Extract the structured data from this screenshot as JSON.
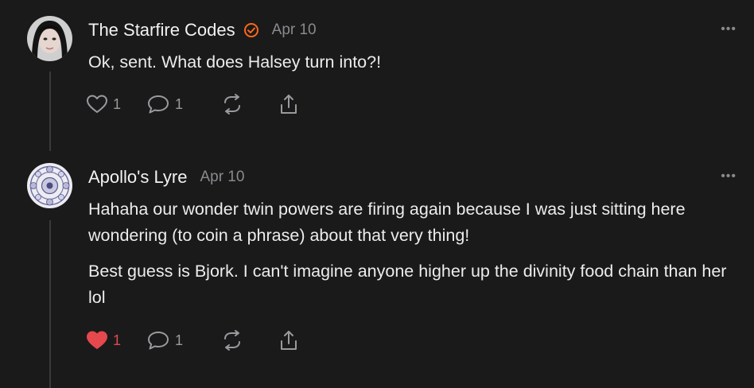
{
  "comments": [
    {
      "author": "The Starfire Codes",
      "date": "Apr 10",
      "verified": true,
      "paragraphs": [
        "Ok, sent. What does Halsey turn into?!"
      ],
      "likes": "1",
      "replies": "1",
      "liked": false,
      "more": "•••"
    },
    {
      "author": "Apollo's Lyre",
      "date": "Apr 10",
      "verified": false,
      "paragraphs": [
        "Hahaha our wonder twin powers are firing again because I was just sitting here wondering (to coin a phrase) about that very thing!",
        "Best guess is Bjork. I can't imagine anyone higher up the divinity food chain than her lol"
      ],
      "likes": "1",
      "replies": "1",
      "liked": true,
      "more": "•••"
    }
  ],
  "colors": {
    "background": "#1a1a1b",
    "badge": "#ff6719",
    "liked_heart": "#e5484d",
    "muted": "#8a8a8e"
  },
  "icons": [
    "heart-icon",
    "comment-icon",
    "restack-icon",
    "share-icon",
    "verified-badge-icon",
    "more-icon"
  ]
}
